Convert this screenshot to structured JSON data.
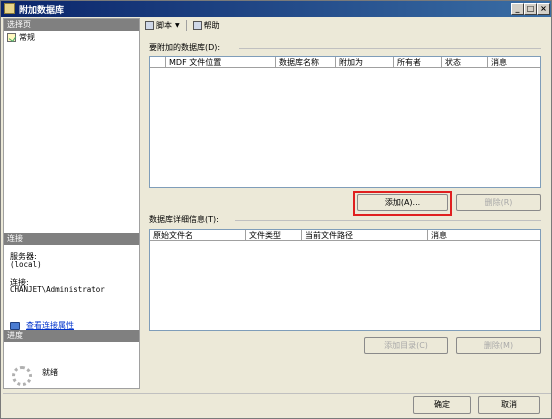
{
  "window": {
    "title": "附加数据库",
    "controls": [
      "minimize",
      "maximize",
      "close"
    ],
    "minimize_glyph": "_",
    "maximize_glyph": "□",
    "close_glyph": "×"
  },
  "left": {
    "select_page_header": "选择页",
    "pages": [
      {
        "label": "常规"
      }
    ],
    "connection_header": "连接",
    "server_label": "服务器:",
    "server_value": "(local)",
    "connection_label": "连接:",
    "connection_value": "CHANJET\\Administrator",
    "view_connection_link": "查看连接属性",
    "progress_header": "进度",
    "progress_status": "就绪"
  },
  "toolbar": {
    "script_label": "脚本",
    "script_chevron": "▼",
    "help_label": "帮助"
  },
  "attach_group": {
    "label": "要附加的数据库(D):",
    "columns": [
      "",
      "MDF 文件位置",
      "数据库名称",
      "附加为",
      "所有者",
      "状态",
      "消息"
    ],
    "rows": []
  },
  "buttons": {
    "add": "添加(A)...",
    "remove": "删除(R)",
    "add_catalog": "添加目录(C)",
    "remove2": "删除(M)",
    "ok": "确定",
    "cancel": "取消"
  },
  "details_group": {
    "label": "数据库详细信息(T):",
    "columns": [
      "原始文件名",
      "文件类型",
      "当前文件路径",
      "消息"
    ],
    "rows": []
  },
  "colors": {
    "highlight": "#e02020",
    "title_gradient_start": "#0a246a",
    "title_gradient_end": "#3a6ea5",
    "link": "#0033cc"
  }
}
